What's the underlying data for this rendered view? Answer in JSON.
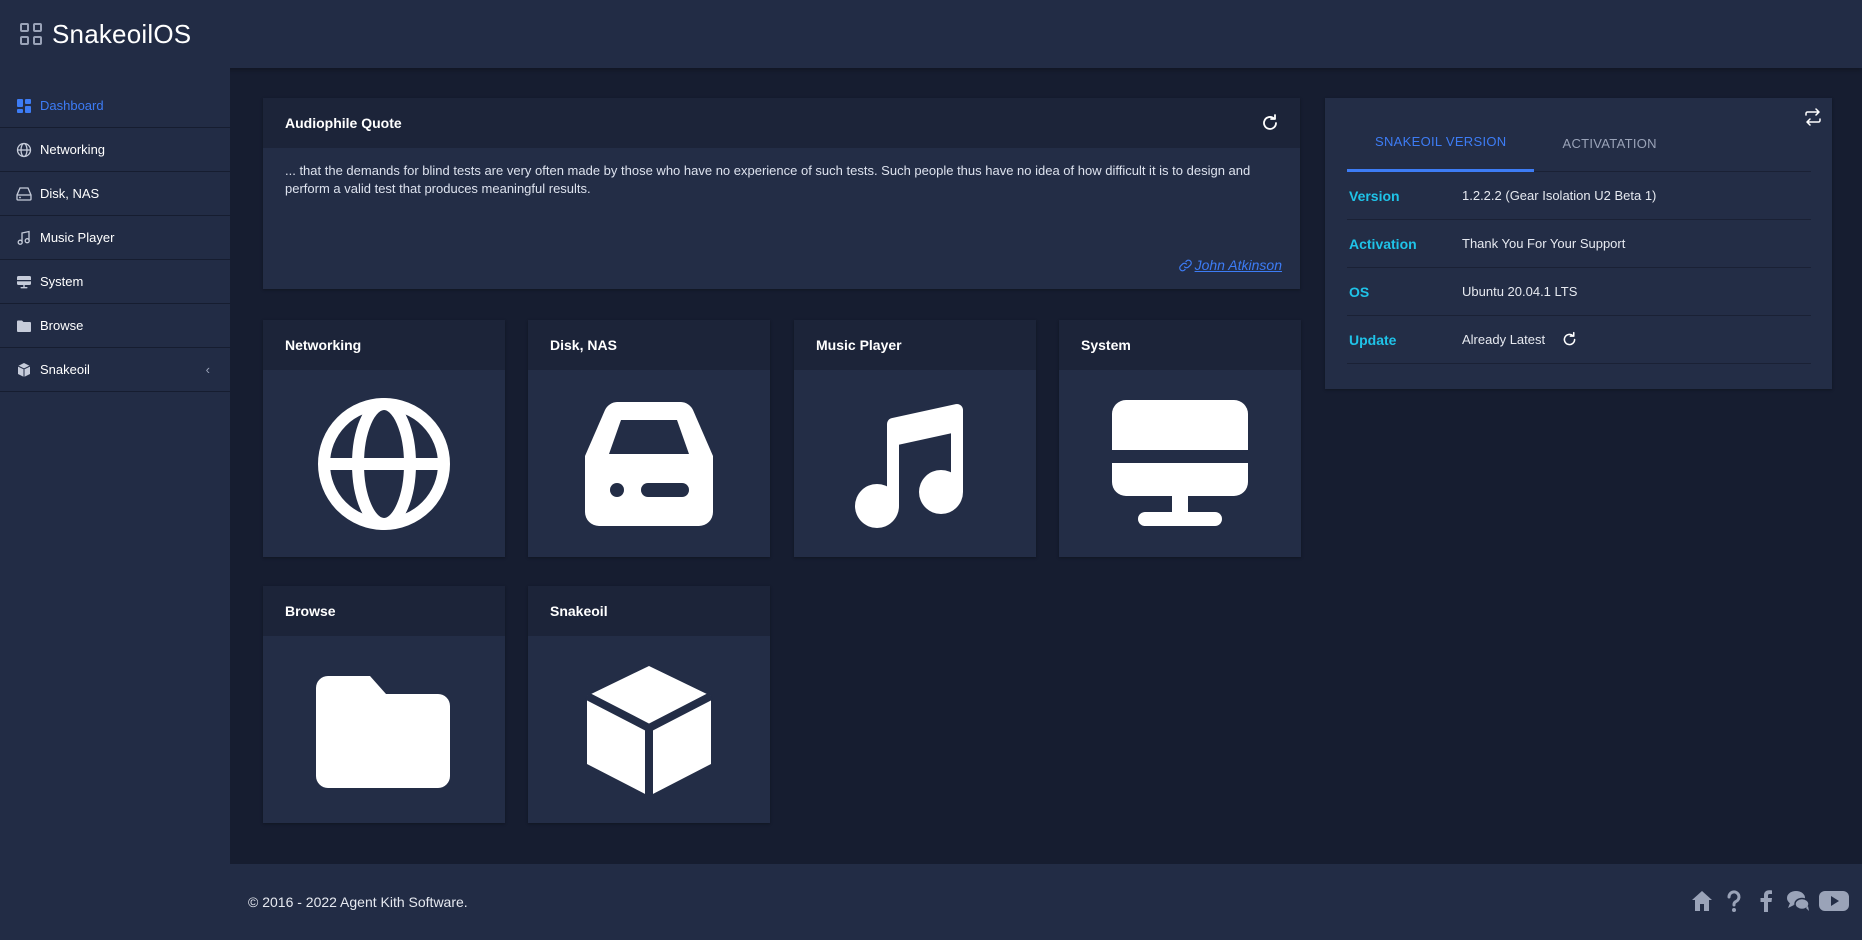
{
  "app": {
    "title": "SnakeoilOS",
    "brand_icon": "grid-icon"
  },
  "sidebar": {
    "items": [
      {
        "label": "Dashboard",
        "icon": "dashboard-icon",
        "active": true
      },
      {
        "label": "Networking",
        "icon": "globe-icon"
      },
      {
        "label": "Disk, NAS",
        "icon": "drive-icon"
      },
      {
        "label": "Music Player",
        "icon": "music-note-icon"
      },
      {
        "label": "System",
        "icon": "monitor-icon"
      },
      {
        "label": "Browse",
        "icon": "folder-icon"
      },
      {
        "label": "Snakeoil",
        "icon": "cube-icon",
        "expand": "‹"
      }
    ]
  },
  "quote": {
    "title": "Audiophile Quote",
    "text": "... that the demands for blind tests are very often made by those who have no experience of such tests. Such people thus have no idea of how difficult it is to design and perform a valid test that produces meaningful results.",
    "author": "John Atkinson"
  },
  "tiles": [
    {
      "label": "Networking",
      "icon": "globe-icon"
    },
    {
      "label": "Disk, NAS",
      "icon": "drive-icon"
    },
    {
      "label": "Music Player",
      "icon": "music-note-icon"
    },
    {
      "label": "System",
      "icon": "monitor-icon"
    },
    {
      "label": "Browse",
      "icon": "folder-icon"
    },
    {
      "label": "Snakeoil",
      "icon": "cube-icon"
    }
  ],
  "version_card": {
    "tabs": [
      {
        "label": "SNAKEOIL VERSION",
        "active": true
      },
      {
        "label": "ACTIVATATION",
        "active": false
      }
    ],
    "rows": [
      {
        "key": "Version",
        "value": "1.2.2.2 (Gear Isolation U2 Beta 1)"
      },
      {
        "key": "Activation",
        "value": "Thank You For Your Support"
      },
      {
        "key": "OS",
        "value": "Ubuntu 20.04.1 LTS"
      },
      {
        "key": "Update",
        "value": "Already Latest"
      }
    ]
  },
  "footer": {
    "copyright": "© 2016 - 2022 Agent Kith Software.",
    "icons": [
      "home-icon",
      "help-icon",
      "facebook-icon",
      "chat-icon",
      "youtube-icon"
    ]
  },
  "colors": {
    "accent": "#3d7cf5",
    "key_text": "#1fc3e8",
    "background": "#161d30",
    "panel": "#222c45"
  }
}
